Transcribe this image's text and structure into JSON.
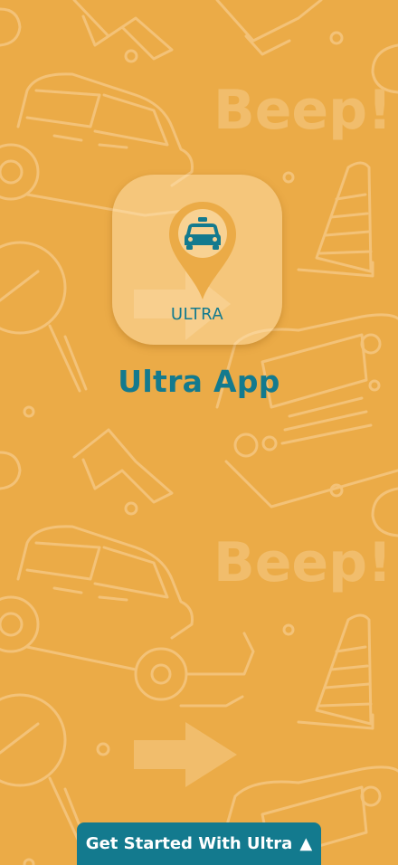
{
  "background": {
    "color": "#ebab47",
    "pattern_color": "#f3c278",
    "pattern_text": "Beep!"
  },
  "logo": {
    "icon": "taxi-location-pin-icon",
    "label": "ULTRA",
    "pin_color": "#ebab47",
    "taxi_color": "#137a8e"
  },
  "app": {
    "title": "Ultra App",
    "title_color": "#137a8e"
  },
  "cta": {
    "label": "Get Started With Ultra",
    "icon": "triangle-up-icon",
    "arrow_glyph": "▲",
    "color": "#137a8e"
  }
}
